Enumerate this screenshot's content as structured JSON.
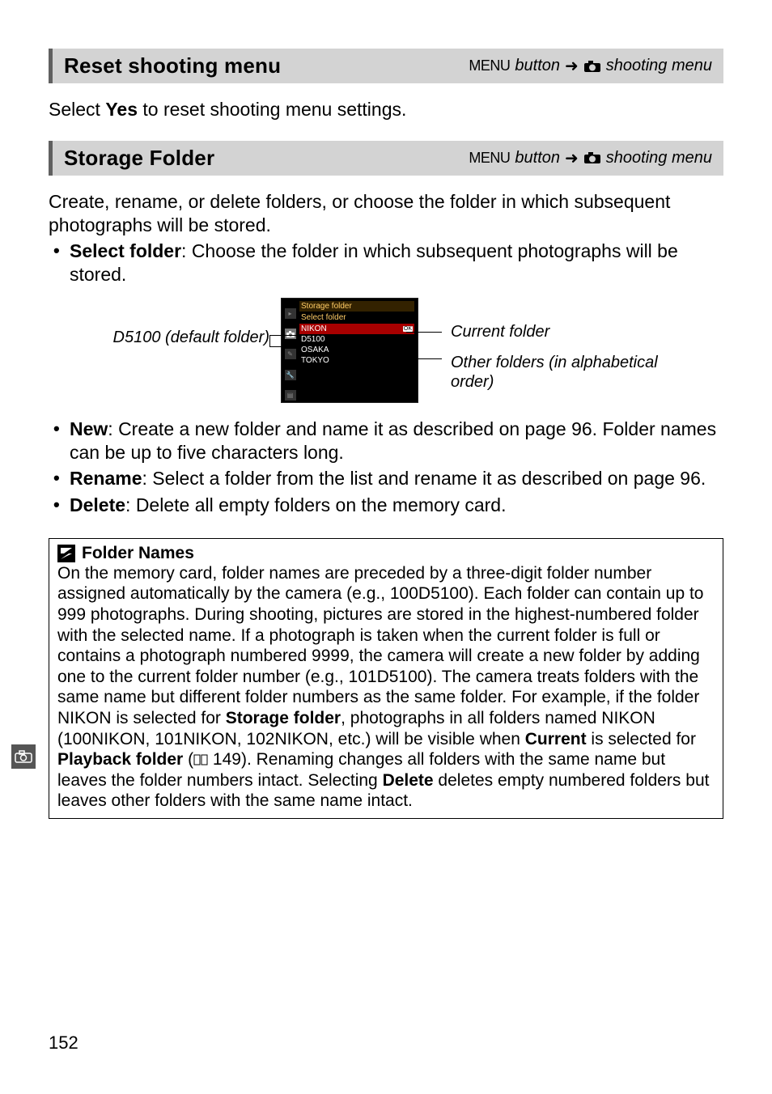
{
  "sections": {
    "reset": {
      "title": "Reset shooting menu",
      "path_menu": "MENU",
      "path_button": " button",
      "path_arrow": "➜",
      "path_shooting": " shooting menu",
      "body_pre": "Select ",
      "body_bold": "Yes",
      "body_post": " to reset shooting menu settings."
    },
    "storage": {
      "title": "Storage Folder",
      "path_menu": "MENU",
      "path_button": " button",
      "path_arrow": "➜",
      "path_shooting": " shooting menu",
      "intro": "Create, rename, or delete folders, or choose the folder in which subsequent photographs will be stored.",
      "items": [
        {
          "label": "Select folder",
          "text": ": Choose the folder in which subsequent photographs will be stored."
        }
      ],
      "items2": [
        {
          "label": "New",
          "text": ": Create a new folder and name it as described on page 96. Folder names can be up to five characters long."
        },
        {
          "label": "Rename",
          "text": ": Select a folder from the list and rename it as described on page 96."
        },
        {
          "label": "Delete",
          "text": ": Delete all empty folders on the memory card."
        }
      ]
    }
  },
  "diagram": {
    "left_label": "D5100 (default folder)",
    "screen_heading": "Storage folder",
    "screen_sub": "Select folder",
    "folders": [
      "NIKON",
      "D5100",
      "OSAKA",
      "TOKYO"
    ],
    "ann1": "Current folder",
    "ann2": "Other folders (in alphabetical order)"
  },
  "note": {
    "title": "Folder Names",
    "b1": "Storage folder",
    "b2": "Current",
    "b3": "Playback folder",
    "b4": "Delete",
    "page_ref": "149",
    "t1": "On the memory card, folder names are preceded by a three-digit folder number assigned automatically by the camera (e.g., 100D5100).  Each folder can contain up to 999 photographs.  During shooting, pictures are stored in the highest-numbered folder with the selected name.  If a photograph is taken when the current folder is full or contains a photograph numbered 9999, the camera will create a new folder by adding one to the current folder number (e.g., 101D5100).  The camera treats folders with the same name but different folder numbers as the same folder.  For example, if the folder NIKON is selected for ",
    "t2": ", photographs in all folders named NIKON (100NIKON, 101NIKON, 102NIKON, etc.) will be visible when ",
    "t3": " is selected for ",
    "t4": " (",
    "t5": " ",
    "t6": ").  Renaming changes all folders with the same name but leaves the folder numbers intact.  Selecting ",
    "t7": " deletes empty numbered folders but leaves other folders with the same name intact."
  },
  "page_number": "152"
}
